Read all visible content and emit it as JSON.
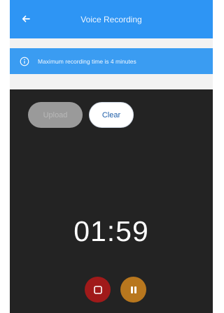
{
  "header": {
    "title": "Voice Recording",
    "back_icon": "arrow-left-icon"
  },
  "info_banner": {
    "icon": "info-circle-icon",
    "text": "Maximum recording time is 4 minutes"
  },
  "buttons": {
    "upload_label": "Upload",
    "clear_label": "Clear"
  },
  "timer": {
    "value": "01:59"
  },
  "controls": {
    "stop_icon": "stop-icon",
    "pause_icon": "pause-icon"
  },
  "colors": {
    "header": "#2e95f4",
    "banner": "#3a9cf2",
    "background": "#232323",
    "stop": "#a01a1a",
    "pause": "#b8771e"
  }
}
